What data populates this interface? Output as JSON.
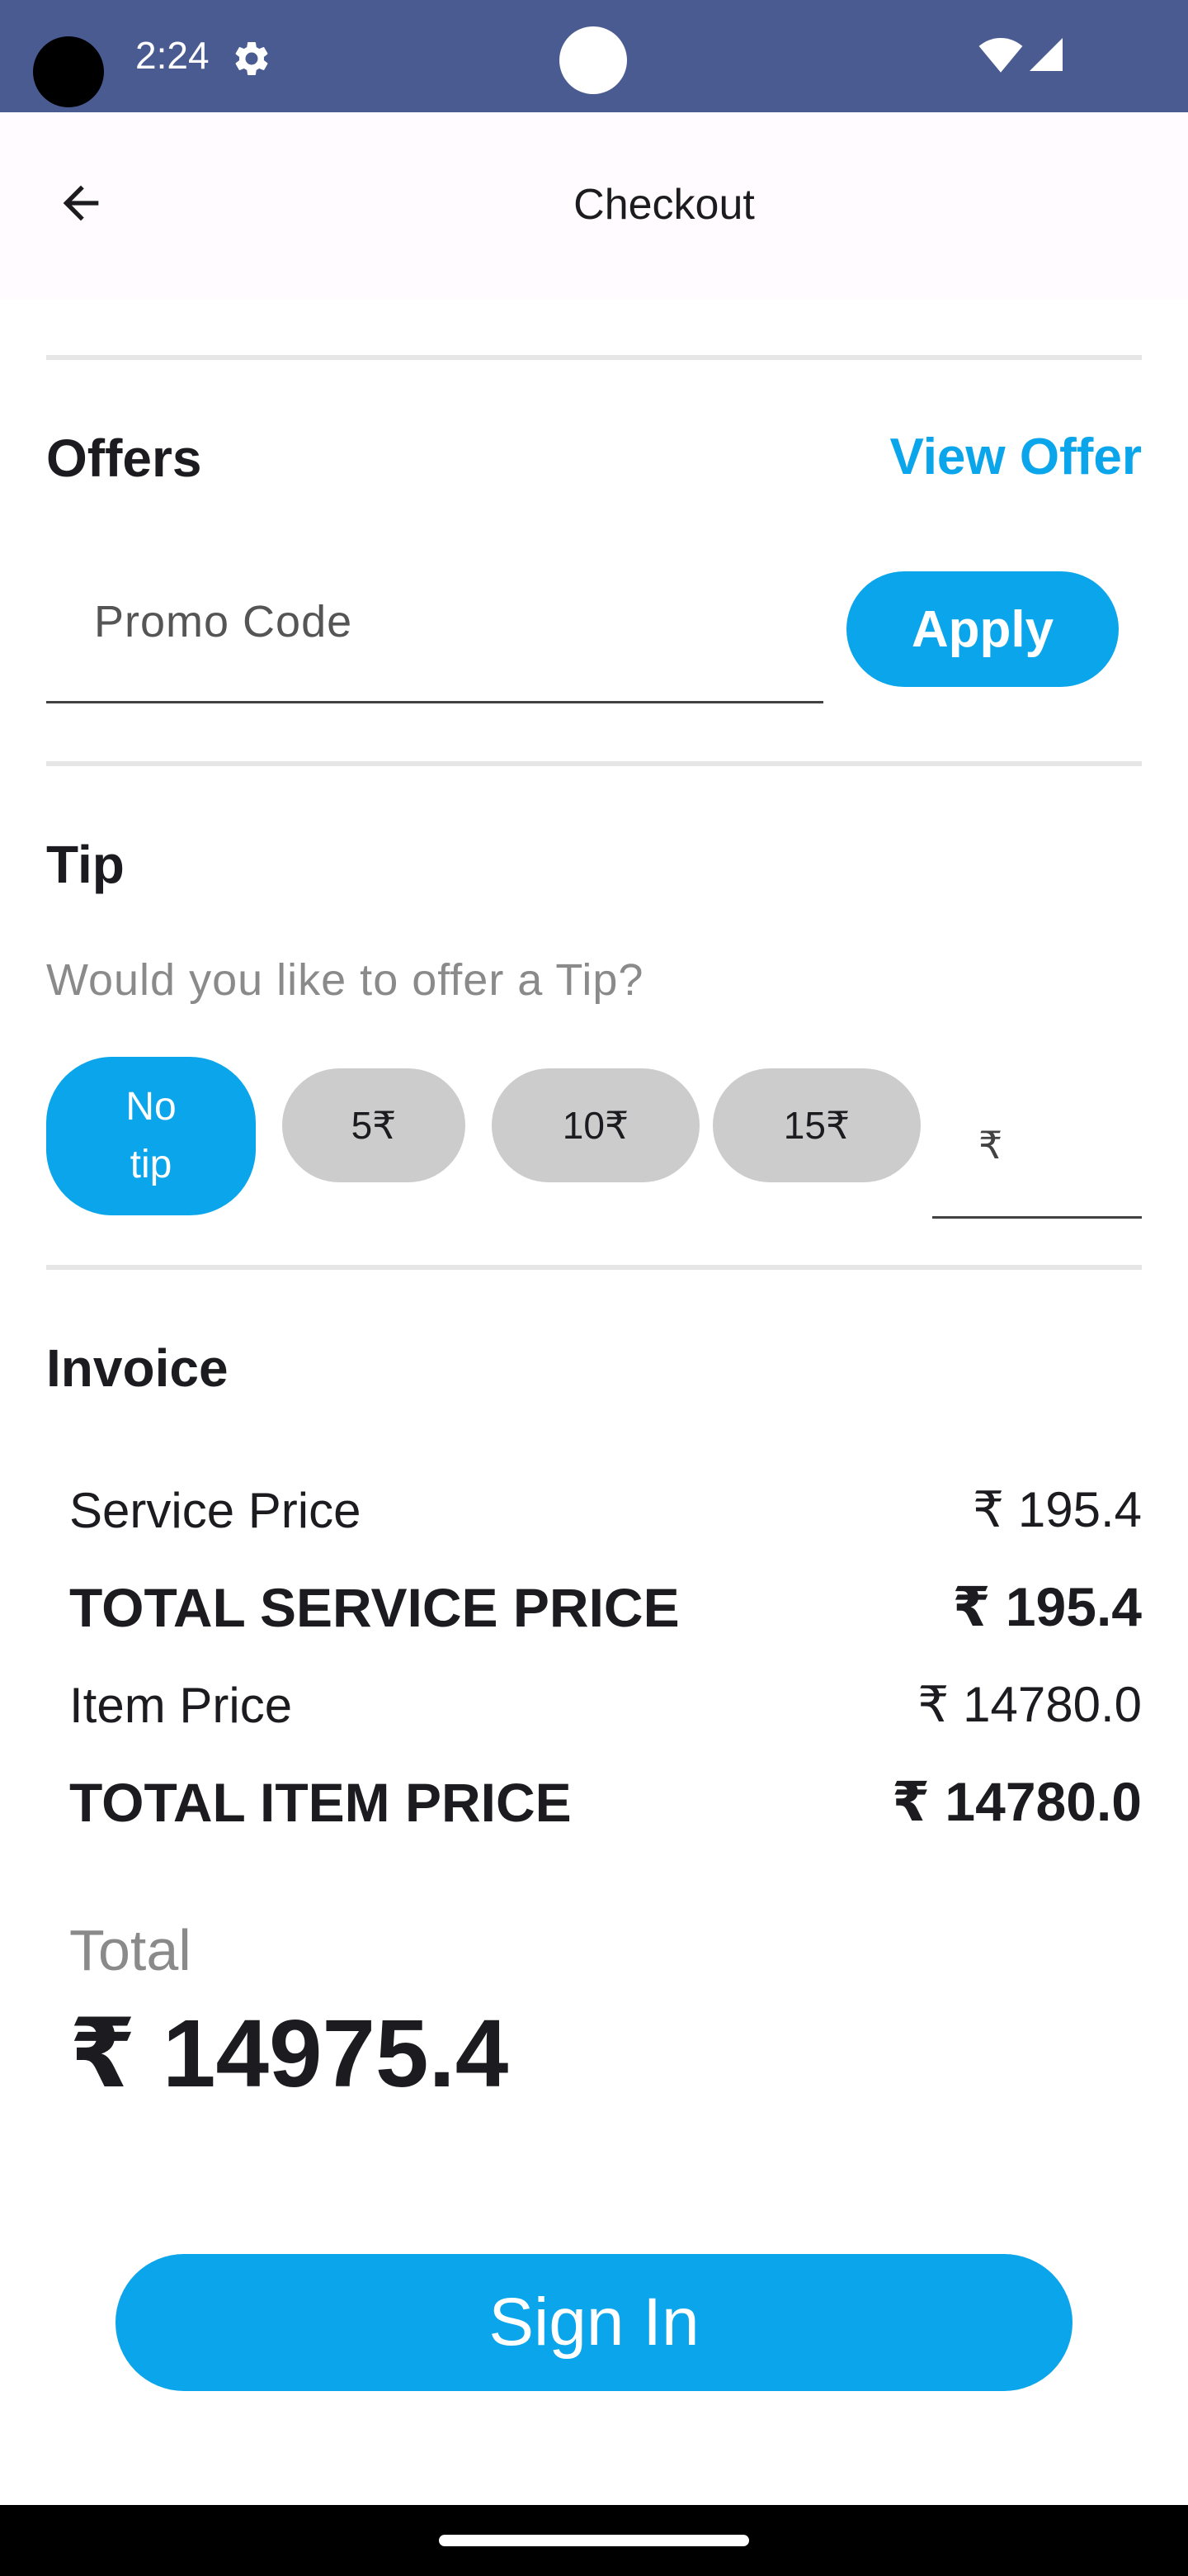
{
  "status_bar": {
    "time": "2:24",
    "icons": [
      "settings-icon",
      "wifi-icon",
      "signal-icon"
    ],
    "background": "#4a5b91"
  },
  "app_bar": {
    "title": "Checkout",
    "back_icon": "arrow-back-icon"
  },
  "offers": {
    "title": "Offers",
    "view_offer_label": "View Offer",
    "promo_placeholder": "Promo Code",
    "promo_value": "",
    "apply_label": "Apply"
  },
  "tip": {
    "title": "Tip",
    "question": "Would you like to offer a Tip?",
    "options": [
      {
        "line1": "No",
        "line2": "tip",
        "selected": true
      },
      {
        "label": "5₹",
        "selected": false
      },
      {
        "label": "10₹",
        "selected": false
      },
      {
        "label": "15₹",
        "selected": false
      }
    ],
    "custom_prefix": "₹"
  },
  "invoice": {
    "title": "Invoice",
    "rows": [
      {
        "label": "Service Price",
        "value": "₹ 195.4",
        "bold": false
      },
      {
        "label": "TOTAL SERVICE PRICE",
        "value": "₹ 195.4",
        "bold": true
      },
      {
        "label": "Item Price",
        "value": "₹ 14780.0",
        "bold": false
      },
      {
        "label": "TOTAL ITEM PRICE",
        "value": "₹ 14780.0",
        "bold": true
      }
    ],
    "total_label": "Total",
    "total_value": "₹ 14975.4"
  },
  "footer": {
    "sign_in_label": "Sign In"
  },
  "colors": {
    "accent": "#0aa5ea",
    "chip_inactive": "#cccccc",
    "status_bar": "#4a5b91"
  }
}
